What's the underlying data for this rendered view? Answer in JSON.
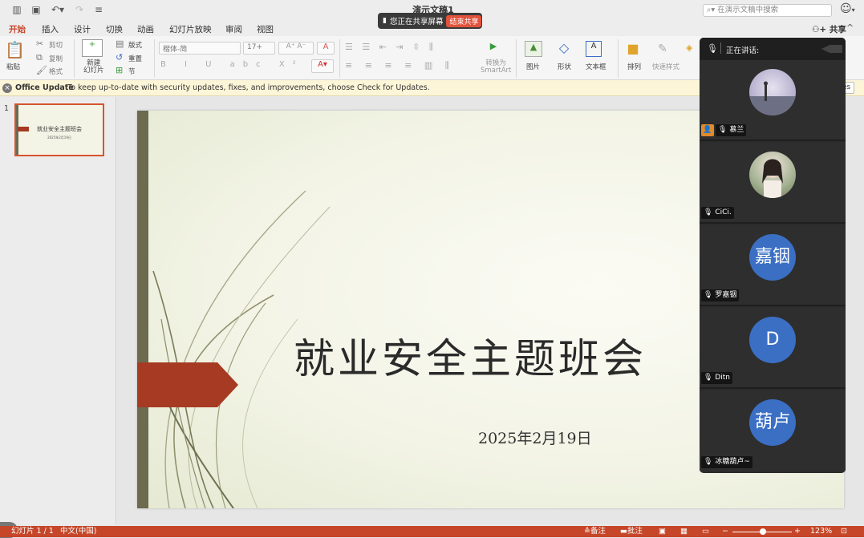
{
  "titlebar": {
    "doc_title": "演示文稿1",
    "share_banner_text": "您正在共享屏幕",
    "end_share_label": "结束共享",
    "search_placeholder": "在演示文稿中搜索"
  },
  "tabs": [
    "开始",
    "插入",
    "设计",
    "切换",
    "动画",
    "幻灯片放映",
    "审阅",
    "视图"
  ],
  "share_label": "共享",
  "ribbon": {
    "paste": "粘贴",
    "cut": "剪切",
    "copy": "复制",
    "format": "格式",
    "new_slide": "新建\n幻灯片",
    "layout": "版式",
    "reset": "重置",
    "section": "节",
    "font_name": "楷体-简",
    "font_size": "17+",
    "convert_smartart": "转换为\nSmartArt",
    "picture": "图片",
    "shape": "形状",
    "textbox": "文本框",
    "arrange": "排列",
    "quick_styles": "快速样式"
  },
  "update_bar": {
    "title": "Office Update",
    "message": "To keep up-to-date with security updates, fixes, and improvements, choose Check for Updates.",
    "button": "es"
  },
  "thumbnail": {
    "number": "1",
    "title": "就业安全主题班会",
    "date": "2025年2月19日"
  },
  "slide": {
    "title": "就业安全主题班会",
    "date": "2025年2月19日",
    "colors": {
      "bar": "#6c6a4f",
      "arrow": "#a63a22",
      "background": "#f3f4e6"
    }
  },
  "meeting": {
    "speaking_label": "正在讲话:",
    "participants": [
      {
        "name": "慕兰",
        "avatar_type": "photo-landscape",
        "host": true
      },
      {
        "name": "CiCi.",
        "avatar_type": "photo-person",
        "host": false
      },
      {
        "name": "罗嘉铟",
        "avatar_text": "嘉铟",
        "avatar_color": "#3a6fc4",
        "host": false
      },
      {
        "name": "Ditn",
        "avatar_text": "D",
        "avatar_color": "#3a6fc4",
        "host": false
      },
      {
        "name": "冰糖葫卢~",
        "avatar_text": "葫卢",
        "avatar_color": "#3a6fc4",
        "host": false
      }
    ]
  },
  "statusbar": {
    "slide_info": "幻灯片 1 / 1",
    "language": "中文(中国)",
    "notes": "备注",
    "comments": "批注",
    "zoom": "123%",
    "zoom_value": 0.46
  }
}
